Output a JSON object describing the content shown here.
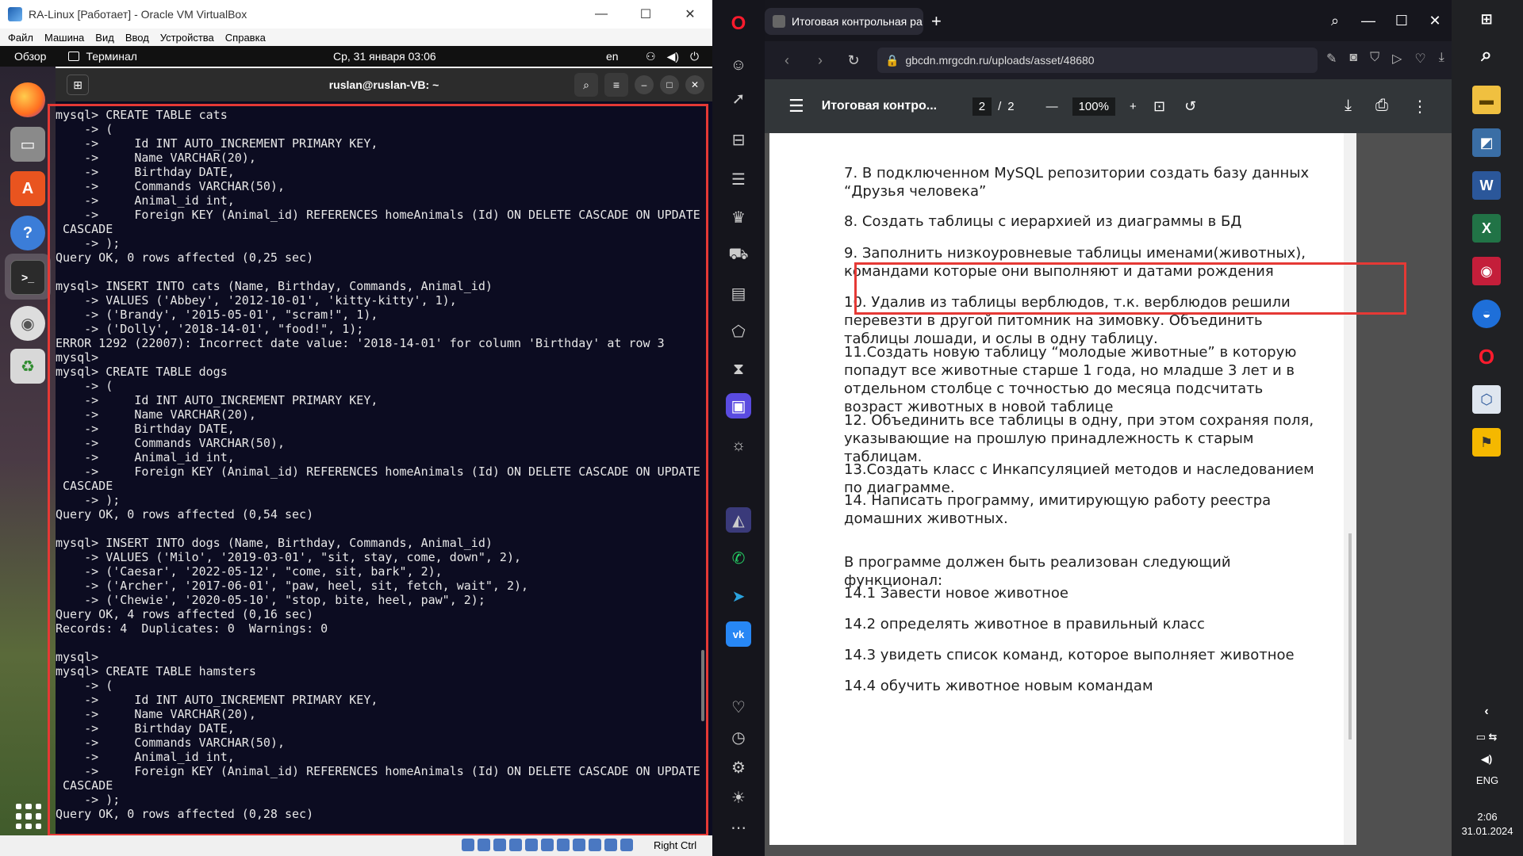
{
  "vbox": {
    "title": "RA-Linux [Работает] - Oracle VM VirtualBox",
    "menu": [
      "Файл",
      "Машина",
      "Вид",
      "Ввод",
      "Устройства",
      "Справка"
    ],
    "host_key": "Right Ctrl"
  },
  "ubuntu": {
    "overview": "Обзор",
    "app": "Терминал",
    "clock": "Ср, 31 января  03:06",
    "lang": "en"
  },
  "terminal": {
    "title": "ruslan@ruslan-VB: ~",
    "lines": [
      "mysql> CREATE TABLE cats",
      "    -> (",
      "    ->     Id INT AUTO_INCREMENT PRIMARY KEY,",
      "    ->     Name VARCHAR(20),",
      "    ->     Birthday DATE,",
      "    ->     Commands VARCHAR(50),",
      "    ->     Animal_id int,",
      "    ->     Foreign KEY (Animal_id) REFERENCES homeAnimals (Id) ON DELETE CASCADE ON UPDATE",
      " CASCADE",
      "    -> );",
      "Query OK, 0 rows affected (0,25 sec)",
      "",
      "mysql> INSERT INTO cats (Name, Birthday, Commands, Animal_id)",
      "    -> VALUES ('Abbey', '2012-10-01', 'kitty-kitty', 1),",
      "    -> ('Brandy', '2015-05-01', \"scram!\", 1),",
      "    -> ('Dolly', '2018-14-01', \"food!\", 1);",
      "ERROR 1292 (22007): Incorrect date value: '2018-14-01' for column 'Birthday' at row 3",
      "mysql>",
      "mysql> CREATE TABLE dogs",
      "    -> (",
      "    ->     Id INT AUTO_INCREMENT PRIMARY KEY,",
      "    ->     Name VARCHAR(20),",
      "    ->     Birthday DATE,",
      "    ->     Commands VARCHAR(50),",
      "    ->     Animal_id int,",
      "    ->     Foreign KEY (Animal_id) REFERENCES homeAnimals (Id) ON DELETE CASCADE ON UPDATE",
      " CASCADE",
      "    -> );",
      "Query OK, 0 rows affected (0,54 sec)",
      "",
      "mysql> INSERT INTO dogs (Name, Birthday, Commands, Animal_id)",
      "    -> VALUES ('Milo', '2019-03-01', \"sit, stay, come, down\", 2),",
      "    -> ('Caesar', '2022-05-12', \"come, sit, bark\", 2),",
      "    -> ('Archer', '2017-06-01', \"paw, heel, sit, fetch, wait\", 2),",
      "    -> ('Chewie', '2020-05-10', \"stop, bite, heel, paw\", 2);",
      "Query OK, 4 rows affected (0,16 sec)",
      "Records: 4  Duplicates: 0  Warnings: 0",
      "",
      "mysql>",
      "mysql> CREATE TABLE hamsters",
      "    -> (",
      "    ->     Id INT AUTO_INCREMENT PRIMARY KEY,",
      "    ->     Name VARCHAR(20),",
      "    ->     Birthday DATE,",
      "    ->     Commands VARCHAR(50),",
      "    ->     Animal_id int,",
      "    ->     Foreign KEY (Animal_id) REFERENCES homeAnimals (Id) ON DELETE CASCADE ON UPDATE",
      " CASCADE",
      "    -> );",
      "Query OK, 0 rows affected (0,28 sec)"
    ]
  },
  "browser": {
    "tab_title": "Итоговая контрольная ра",
    "url": "gbcdn.mrgcdn.ru/uploads/asset/48680",
    "pdf": {
      "title": "Итоговая контро...",
      "page": "2",
      "page_sep": "/",
      "total": "2",
      "zoom": "100%",
      "paragraphs": [
        "7. В подключенном MySQL репозитории создать базу данных “Друзья человека”",
        "8. Создать таблицы с иерархией из диаграммы в БД",
        "9.  Заполнить низкоуровневые таблицы именами(животных), командами которые они выполняют и датами рождения",
        "10.  Удалив из таблицы верблюдов, т.к. верблюдов решили перевезти в другой питомник на зимовку. Объединить таблицы лошади, и ослы в одну таблицу.",
        "11.Создать новую таблицу “молодые животные” в которую попадут все животные старше 1 года, но младше 3 лет и в отдельном столбце с точностью до месяца подсчитать возраст животных в новой таблице",
        "12. Объединить все таблицы в одну, при этом сохраняя поля, указывающие на прошлую принадлежность к старым таблицам.",
        "13.Создать класс с Инкапсуляцией методов и наследованием по диаграмме.",
        "14. Написать программу, имитирующую работу реестра домашних животных.",
        "В программе должен быть реализован следующий функционал:",
        "14.1 Завести новое животное",
        "14.2 определять животное в правильный класс",
        "14.3 увидеть список команд, которое выполняет животное",
        "14.4 обучить животное новым командам"
      ]
    }
  },
  "taskbar": {
    "lang": "ENG",
    "time": "2:06",
    "date": "31.01.2024"
  }
}
